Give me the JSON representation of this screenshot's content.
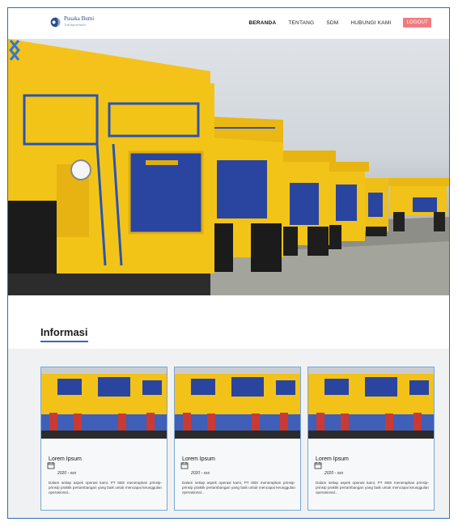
{
  "brand": {
    "name": "Pusaka Bumi",
    "subtitle": "Transportindo"
  },
  "nav": {
    "items": [
      {
        "label": "BERANDA",
        "active": true
      },
      {
        "label": "TENTANG"
      },
      {
        "label": "SDM"
      },
      {
        "label": "HUBUNGI KAMI"
      }
    ],
    "logout_label": "LOGOUT"
  },
  "hero": {
    "icon_prev": "chevron-left-icon",
    "icon_next": "chevron-right-icon"
  },
  "section": {
    "title": "Informasi"
  },
  "cards": [
    {
      "title": "Lorem Ipsum",
      "date": "2020 - xxx",
      "description": "Dalam setiap aspek operasi kami, PT SBS menerapkan prinsip-prinsip praktik pertambangan yang baik untuk mencapai keunggulan operasional...",
      "icon": "calendar-icon"
    },
    {
      "title": "Lorem Ipsum",
      "date": "2020 - xxx",
      "description": "Dalam setiap aspek operasi kami, PT SBS menerapkan prinsip-prinsip praktik pertambangan yang baik untuk mencapai keunggulan operasional...",
      "icon": "calendar-icon"
    },
    {
      "title": "Lorem Ipsum",
      "date": "2020 - xxx",
      "description": "Dalam setiap aspek operasi kami, PT SBS menerapkan prinsip-prinsip praktik pertambangan yang baik untuk mencapai keunggulan operasional...",
      "icon": "calendar-icon"
    }
  ],
  "colors": {
    "accent": "#2f6db0",
    "logout": "#f07b80",
    "truck_yellow": "#f3c418",
    "truck_blue": "#2847a6"
  }
}
